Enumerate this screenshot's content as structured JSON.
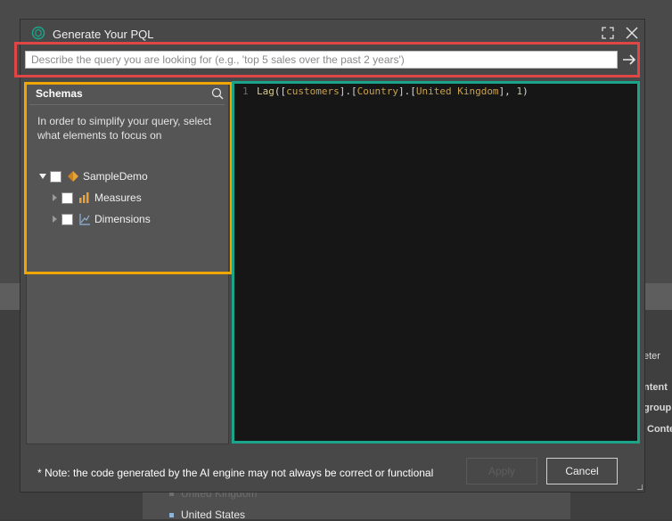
{
  "dialog": {
    "title": "Generate Your PQL",
    "prompt_placeholder": "Describe the query you are looking for (e.g., 'top 5 sales over the past 2 years')",
    "schemas": {
      "heading": "Schemas",
      "hint": "In order to simplify your query, select what elements to focus on",
      "tree": [
        {
          "label": "SampleDemo",
          "icon": "cube-icon",
          "expanded": true,
          "checked": false
        },
        {
          "label": "Measures",
          "icon": "bar-chart-icon",
          "expanded": false,
          "checked": false
        },
        {
          "label": "Dimensions",
          "icon": "hierarchy-icon",
          "expanded": false,
          "checked": false
        }
      ]
    },
    "code": {
      "line_number": "1",
      "function": "Lag",
      "id_customers": "customers",
      "id_country": "Country",
      "id_uk": "United Kingdom",
      "arg": "1"
    },
    "note": "* Note: the code generated by the AI engine may not always be correct or functional",
    "apply_label": "Apply",
    "cancel_label": "Cancel"
  },
  "background": {
    "right_items": [
      "eter",
      "ntent",
      "group",
      "Conte"
    ],
    "list_items": [
      "United Kingdom",
      "United States"
    ]
  },
  "colors": {
    "prompt_highlight": "#e04646",
    "schemas_highlight": "#f0a500",
    "editor_highlight": "#1aa58a"
  }
}
